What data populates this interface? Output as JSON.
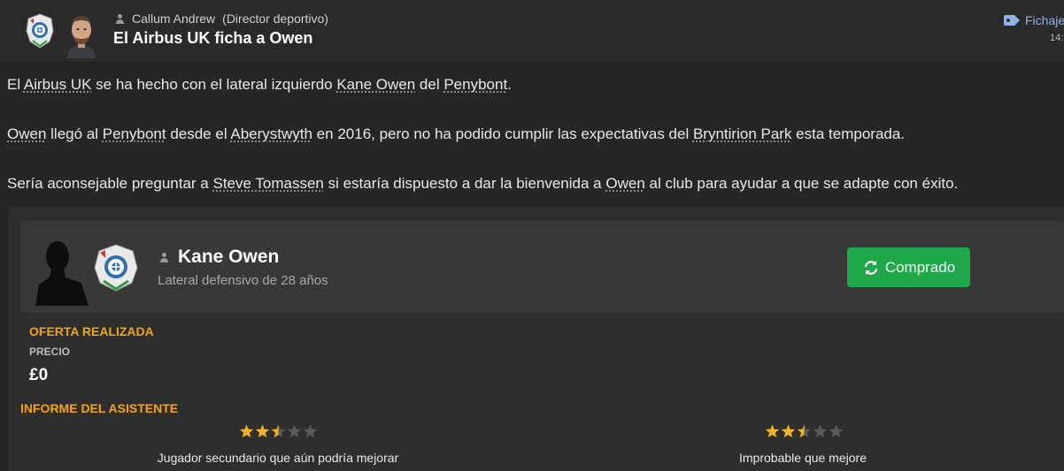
{
  "header": {
    "sender_name": "Callum Andrew",
    "sender_role": "(Director deportivo)",
    "title": "El Airbus UK ficha a Owen",
    "tag_label": "Fichaje",
    "time": "14:"
  },
  "body": {
    "p1": {
      "t1": "El ",
      "club": "Airbus UK",
      "t2": " se ha hecho con el lateral izquierdo ",
      "player": "Kane Owen",
      "t3": " del ",
      "old_club": "Penybont",
      "t4": "."
    },
    "p2": {
      "player": "Owen",
      "t1": " llegó al ",
      "club": "Penybont",
      "t2": " desde el ",
      "prev_club": "Aberystwyth",
      "t3": " en 2016, pero no ha podido cumplir las expectativas del ",
      "stadium": "Bryntirion Park",
      "t4": " esta temporada."
    },
    "p3": {
      "t1": "Sería aconsejable preguntar a ",
      "person": "Steve Tomassen",
      "t2": " si estaría dispuesto a dar la bienvenida a ",
      "player": "Owen",
      "t3": " al club para ayudar a que se adapte con éxito."
    }
  },
  "player_card": {
    "name": "Kane Owen",
    "description": "Lateral defensivo de 28 años",
    "status_label": "Comprado"
  },
  "offer": {
    "title": "OFERTA REALIZADA",
    "price_label": "PRECIO",
    "price_value": "£0"
  },
  "report": {
    "title": "INFORME DEL ASISTENTE",
    "current_ability": {
      "stars": 2.5,
      "max": 5,
      "text": "Jugador secundario que aún podría mejorar"
    },
    "potential_ability": {
      "stars": 2.5,
      "max": 5,
      "text": "Improbable que mejore"
    }
  },
  "colors": {
    "background": "#262626",
    "accent_orange": "#f2a516",
    "status_green": "#1ea84a",
    "tag_blue": "#8fb3e6",
    "star_gold": "#f0b51e"
  }
}
